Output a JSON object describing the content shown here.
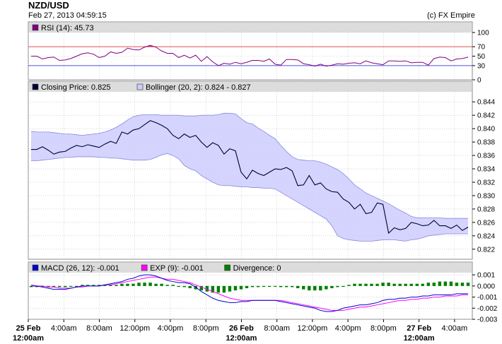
{
  "header": {
    "title": "NZD/USD",
    "timestamp": "Feb 27, 2013 04:59:15",
    "copyright": "(c) FX Empire"
  },
  "colors": {
    "rsi": "#800080",
    "rsi_fill_overbought": "#ff0000",
    "rsi_fill_oversold": "#0000ff",
    "rsi_upper_line": "#e05050",
    "rsi_lower_line": "#5050e0",
    "close": "#000033",
    "band_fill": "#ccccff",
    "band_edge": "#8888dd",
    "macd": "#0000cc",
    "exp": "#ff00ff",
    "divergence": "#008000",
    "legend_strip": "#dcdcdc",
    "grid": "#bbbbbb"
  },
  "chart_data": [
    {
      "type": "line",
      "name": "rsi-panel",
      "legend": [
        {
          "label": "RSI (14): 45.73",
          "color": "#800080"
        }
      ],
      "ylim": [
        0,
        100
      ],
      "y_ticks": [
        "100",
        "70",
        "50",
        "30",
        "0"
      ],
      "y_tick_values": [
        100,
        70,
        50,
        30,
        0
      ],
      "reference_lines": [
        70,
        30
      ],
      "x": [
        0,
        1,
        2,
        3,
        4,
        5,
        6,
        7,
        8,
        9,
        10,
        11,
        12,
        13,
        14,
        15,
        16,
        17,
        18,
        19,
        20,
        21,
        22,
        23,
        24,
        25,
        26,
        27,
        28,
        29,
        30,
        31,
        32,
        33,
        34,
        35,
        36,
        37,
        38,
        39,
        40,
        41,
        42,
        43,
        44,
        45,
        46,
        47,
        48,
        49,
        50,
        51,
        52,
        53,
        54,
        55,
        56,
        57,
        58,
        59,
        60,
        61,
        62,
        63,
        64,
        65,
        66,
        67,
        68,
        69,
        70,
        71,
        72,
        73,
        74,
        75,
        76,
        77
      ],
      "series": [
        {
          "name": "RSI",
          "values": [
            50,
            50,
            44,
            47,
            48,
            41,
            42,
            45,
            50,
            55,
            57,
            54,
            47,
            50,
            59,
            56,
            58,
            67,
            64,
            63,
            69,
            73,
            69,
            61,
            56,
            56,
            47,
            52,
            46,
            52,
            39,
            49,
            38,
            30,
            35,
            33,
            37,
            34,
            37,
            41,
            41,
            39,
            44,
            33,
            31,
            43,
            43,
            42,
            34,
            32,
            29,
            33,
            29,
            31,
            34,
            33,
            35,
            36,
            34,
            40,
            36,
            34,
            32,
            40,
            40,
            39,
            40,
            36,
            37,
            37,
            31,
            45,
            48,
            47,
            40,
            44,
            45,
            48
          ]
        }
      ]
    },
    {
      "type": "line",
      "name": "price-panel",
      "legend": [
        {
          "label": "Closing Price: 0.825",
          "color": "#000033"
        },
        {
          "label": "Bollinger (20, 2): 0.824 - 0.827",
          "color": "#ccccff"
        }
      ],
      "ylim": [
        0.8205,
        0.8455
      ],
      "y_ticks": [
        "0.844",
        "0.842",
        "0.840",
        "0.838",
        "0.836",
        "0.834",
        "0.832",
        "0.830",
        "0.828",
        "0.826",
        "0.824",
        "0.822"
      ],
      "y_tick_values": [
        0.844,
        0.842,
        0.84,
        0.838,
        0.836,
        0.834,
        0.832,
        0.83,
        0.828,
        0.826,
        0.824,
        0.822
      ],
      "x": [
        0,
        1,
        2,
        3,
        4,
        5,
        6,
        7,
        8,
        9,
        10,
        11,
        12,
        13,
        14,
        15,
        16,
        17,
        18,
        19,
        20,
        21,
        22,
        23,
        24,
        25,
        26,
        27,
        28,
        29,
        30,
        31,
        32,
        33,
        34,
        35,
        36,
        37,
        38,
        39,
        40,
        41,
        42,
        43,
        44,
        45,
        46,
        47,
        48,
        49,
        50,
        51,
        52,
        53,
        54,
        55,
        56,
        57,
        58,
        59,
        60,
        61,
        62,
        63,
        64,
        65,
        66,
        67,
        68,
        69,
        70,
        71,
        72,
        73,
        74,
        75,
        76,
        77
      ],
      "series": [
        {
          "name": "Closing Price",
          "values": [
            0.8369,
            0.8369,
            0.8373,
            0.8368,
            0.8362,
            0.8365,
            0.8366,
            0.8371,
            0.8375,
            0.8373,
            0.8376,
            0.8374,
            0.8372,
            0.8377,
            0.8381,
            0.8378,
            0.8395,
            0.8392,
            0.8398,
            0.84,
            0.8406,
            0.8412,
            0.8409,
            0.8405,
            0.84,
            0.839,
            0.8385,
            0.8392,
            0.8387,
            0.839,
            0.838,
            0.8372,
            0.8379,
            0.8375,
            0.8362,
            0.837,
            0.8367,
            0.8335,
            0.8325,
            0.8338,
            0.8333,
            0.833,
            0.8335,
            0.834,
            0.8339,
            0.8342,
            0.8337,
            0.8315,
            0.8316,
            0.833,
            0.8316,
            0.8319,
            0.831,
            0.8306,
            0.8305,
            0.8295,
            0.829,
            0.828,
            0.8287,
            0.8273,
            0.8275,
            0.8289,
            0.8287,
            0.8244,
            0.8252,
            0.8249,
            0.8251,
            0.826,
            0.8258,
            0.8255,
            0.8256,
            0.8263,
            0.8255,
            0.8255,
            0.8251,
            0.8256,
            0.8248,
            0.8253
          ]
        },
        {
          "name": "Bollinger Upper",
          "values": [
            0.8396,
            0.8395,
            0.8395,
            0.8395,
            0.8394,
            0.8393,
            0.8392,
            0.8392,
            0.8391,
            0.839,
            0.8391,
            0.8392,
            0.8393,
            0.8395,
            0.8398,
            0.8402,
            0.8407,
            0.8413,
            0.8418,
            0.842,
            0.8421,
            0.8421,
            0.8421,
            0.842,
            0.842,
            0.842,
            0.842,
            0.8419,
            0.8419,
            0.8419,
            0.842,
            0.842,
            0.842,
            0.8421,
            0.8423,
            0.8423,
            0.8422,
            0.8415,
            0.8409,
            0.8407,
            0.8401,
            0.8396,
            0.839,
            0.8385,
            0.8375,
            0.8366,
            0.8358,
            0.8354,
            0.8353,
            0.8352,
            0.8352,
            0.835,
            0.8347,
            0.8343,
            0.8339,
            0.8333,
            0.8325,
            0.8316,
            0.831,
            0.8304,
            0.83,
            0.8296,
            0.8292,
            0.8288,
            0.8283,
            0.8278,
            0.8274,
            0.8269,
            0.8267,
            0.8267,
            0.8267,
            0.8267,
            0.8267,
            0.8266,
            0.8266,
            0.8266,
            0.8266,
            0.8266
          ]
        },
        {
          "name": "Bollinger Lower",
          "values": [
            0.8352,
            0.8352,
            0.8353,
            0.8354,
            0.8355,
            0.8356,
            0.8357,
            0.8357,
            0.8358,
            0.8358,
            0.8358,
            0.8358,
            0.8357,
            0.8357,
            0.8356,
            0.8356,
            0.8355,
            0.8354,
            0.8353,
            0.8353,
            0.8353,
            0.8354,
            0.8357,
            0.8361,
            0.8363,
            0.836,
            0.8355,
            0.8345,
            0.834,
            0.8337,
            0.833,
            0.8325,
            0.832,
            0.8316,
            0.8315,
            0.8315,
            0.8314,
            0.8313,
            0.8313,
            0.8312,
            0.8312,
            0.8311,
            0.8311,
            0.831,
            0.8305,
            0.83,
            0.8295,
            0.829,
            0.8285,
            0.828,
            0.8275,
            0.827,
            0.8265,
            0.8255,
            0.824,
            0.8236,
            0.8234,
            0.8233,
            0.8232,
            0.8232,
            0.8232,
            0.8233,
            0.8234,
            0.8234,
            0.8234,
            0.8233,
            0.8232,
            0.8234,
            0.8235,
            0.8237,
            0.824,
            0.8241,
            0.8242,
            0.8243,
            0.8243,
            0.8243,
            0.8243,
            0.8243
          ]
        }
      ]
    },
    {
      "type": "bar",
      "name": "macd-panel",
      "legend": [
        {
          "label": "MACD (26, 12): -0.001",
          "color": "#0000cc"
        },
        {
          "label": "EXP (9): -0.001",
          "color": "#ff00ff"
        },
        {
          "label": "Divergence: 0",
          "color": "#008000"
        }
      ],
      "ylim": [
        -0.003,
        0.0012
      ],
      "y_ticks": [
        "0.001",
        "0.000",
        "-0.001",
        "-0.002",
        "-0.003"
      ],
      "y_tick_values": [
        0.001,
        0.0,
        -0.001,
        -0.002,
        -0.003
      ],
      "x": [
        0,
        1,
        2,
        3,
        4,
        5,
        6,
        7,
        8,
        9,
        10,
        11,
        12,
        13,
        14,
        15,
        16,
        17,
        18,
        19,
        20,
        21,
        22,
        23,
        24,
        25,
        26,
        27,
        28,
        29,
        30,
        31,
        32,
        33,
        34,
        35,
        36,
        37,
        38,
        39,
        40,
        41,
        42,
        43,
        44,
        45,
        46,
        47,
        48,
        49,
        50,
        51,
        52,
        53,
        54,
        55,
        56,
        57,
        58,
        59,
        60,
        61,
        62,
        63,
        64,
        65,
        66,
        67,
        68,
        69,
        70,
        71,
        72,
        73,
        74,
        75,
        76,
        77
      ],
      "series": [
        {
          "name": "MACD",
          "values": [
            0.0,
            0.0,
            -0.0001,
            -0.0002,
            -0.0003,
            -0.0003,
            -0.0003,
            -0.0002,
            -0.0001,
            0.0,
            0.0,
            0.0,
            0.0,
            0.0001,
            0.0002,
            0.0003,
            0.0004,
            0.0006,
            0.0007,
            0.0009,
            0.001,
            0.001,
            0.0009,
            0.0007,
            0.0005,
            0.0004,
            0.0003,
            0.0003,
            0.0002,
            -0.0001,
            -0.0005,
            -0.0008,
            -0.0011,
            -0.0013,
            -0.0014,
            -0.0015,
            -0.0015,
            -0.0014,
            -0.0014,
            -0.0013,
            -0.0013,
            -0.0013,
            -0.0013,
            -0.0013,
            -0.0014,
            -0.0015,
            -0.0016,
            -0.0017,
            -0.0018,
            -0.0019,
            -0.002,
            -0.0022,
            -0.0023,
            -0.0023,
            -0.0022,
            -0.002,
            -0.0019,
            -0.0018,
            -0.0017,
            -0.0017,
            -0.0016,
            -0.0015,
            -0.0013,
            -0.0012,
            -0.0012,
            -0.0011,
            -0.0011,
            -0.001,
            -0.001,
            -0.0009,
            -0.0009,
            -0.0008,
            -0.0008,
            -0.0008,
            -0.0008,
            -0.0007,
            -0.0007,
            -0.0007
          ]
        },
        {
          "name": "EXP",
          "values": [
            0.0001,
            0.0,
            0.0,
            -0.0001,
            -0.0001,
            -0.0002,
            -0.0002,
            -0.0002,
            -0.0001,
            -0.0001,
            0.0,
            0.0,
            0.0,
            0.0001,
            0.0001,
            0.0002,
            0.0003,
            0.0004,
            0.0005,
            0.0006,
            0.0007,
            0.0008,
            0.0008,
            0.0007,
            0.0006,
            0.0006,
            0.0005,
            0.0004,
            0.0003,
            0.0001,
            -0.0001,
            -0.0003,
            -0.0005,
            -0.0007,
            -0.0009,
            -0.0011,
            -0.0012,
            -0.0013,
            -0.0013,
            -0.0013,
            -0.0013,
            -0.0013,
            -0.0013,
            -0.0013,
            -0.0013,
            -0.0014,
            -0.0015,
            -0.0016,
            -0.0017,
            -0.0018,
            -0.0019,
            -0.002,
            -0.0021,
            -0.0022,
            -0.0022,
            -0.0022,
            -0.0021,
            -0.002,
            -0.0019,
            -0.0019,
            -0.0018,
            -0.0017,
            -0.0016,
            -0.0015,
            -0.0014,
            -0.0013,
            -0.0013,
            -0.0012,
            -0.0012,
            -0.0011,
            -0.0011,
            -0.001,
            -0.001,
            -0.0009,
            -0.0009,
            -0.0009,
            -0.0008,
            -0.0008
          ]
        },
        {
          "name": "Divergence",
          "values": [
            -0.0001,
            -0.0001,
            -0.0001,
            -0.0001,
            -0.0001,
            -0.0001,
            -0.0001,
            0.0,
            0.0,
            0.0001,
            0.0001,
            0.0001,
            0.0001,
            0.0001,
            0.0001,
            0.0001,
            0.0002,
            0.0002,
            0.0002,
            0.0003,
            0.0003,
            0.0003,
            0.0002,
            0.0002,
            0.0001,
            0.0001,
            0.0,
            -0.0001,
            -0.0002,
            -0.0003,
            -0.0004,
            -0.0005,
            -0.0006,
            -0.0006,
            -0.0006,
            -0.0005,
            -0.0004,
            -0.0003,
            -0.0002,
            -0.0001,
            -0.0001,
            0.0,
            0.0,
            0.0,
            -0.0001,
            -0.0001,
            -0.0001,
            -0.0002,
            -0.0003,
            -0.0004,
            -0.0004,
            -0.0004,
            -0.0003,
            -0.0002,
            -0.0001,
            0.0,
            0.0001,
            0.0002,
            0.0002,
            0.0002,
            0.0002,
            0.0002,
            0.0003,
            0.0003,
            0.0002,
            0.0002,
            0.0002,
            0.0002,
            0.0002,
            0.0002,
            0.0003,
            0.0003,
            0.0004,
            0.0004,
            0.0004,
            0.0003,
            0.0003,
            0.0003
          ]
        }
      ]
    }
  ],
  "x_axis": {
    "labels": [
      {
        "text": "25 Feb",
        "sub": "12:00am",
        "bold": true,
        "at": 0
      },
      {
        "text": "4:00am",
        "sub": "",
        "bold": false,
        "at": 4
      },
      {
        "text": "8:00am",
        "sub": "",
        "bold": false,
        "at": 8
      },
      {
        "text": "12:00pm",
        "sub": "",
        "bold": false,
        "at": 12
      },
      {
        "text": "4:00pm",
        "sub": "",
        "bold": false,
        "at": 16
      },
      {
        "text": "8:00pm",
        "sub": "",
        "bold": false,
        "at": 20
      },
      {
        "text": "26 Feb",
        "sub": "12:00am",
        "bold": true,
        "at": 24
      },
      {
        "text": "8:00am",
        "sub": "",
        "bold": false,
        "at": 28
      },
      {
        "text": "12:00pm",
        "sub": "",
        "bold": false,
        "at": 32
      },
      {
        "text": "4:00pm",
        "sub": "",
        "bold": false,
        "at": 36
      },
      {
        "text": "8:00pm",
        "sub": "",
        "bold": false,
        "at": 40
      },
      {
        "text": "27 Feb",
        "sub": "12:00am",
        "bold": true,
        "at": 44
      },
      {
        "text": "4:00am",
        "sub": "",
        "bold": false,
        "at": 48
      }
    ],
    "domain": [
      0,
      50
    ]
  }
}
